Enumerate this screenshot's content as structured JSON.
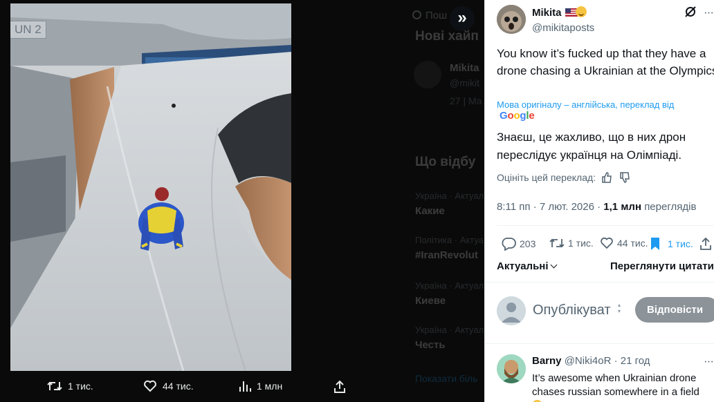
{
  "viewer": {
    "photo_badge": "UN 2",
    "background_page": {
      "search_placeholder": "Пош",
      "heading": "Нові хайп",
      "user_name": "Mikita",
      "user_handle": "@mikit",
      "user_date": "27 | Ма",
      "trends_heading": "Що відбу",
      "trends": [
        {
          "category": "Україна · Актуал",
          "title": "Какие"
        },
        {
          "category": "Політика · Актуа",
          "title": "#IranRevolut"
        },
        {
          "category": "Україна · Актуал",
          "title": "Киеве"
        },
        {
          "category": "Україна · Актуал",
          "title": "Честь"
        }
      ],
      "show_more": "Показати біль"
    },
    "actions": {
      "retweets": "1 тис.",
      "likes": "44 тис.",
      "views": "1 млн"
    }
  },
  "tweet": {
    "author_name": "Mikita",
    "author_handle": "@mikitaposts",
    "text": "You know it’s fucked up that they have a drone chasing a Ukrainian at the Olympics",
    "translation_note": "Мова оригіналу – англійська, переклад від",
    "translation_provider": "Google",
    "translated_text": "Знаєш, це жахливо, що в них дрон переслідує українця на Олімпіаді.",
    "rate_label": "Оцініть цей переклад:",
    "time": "8:11 пп",
    "date": "7 лют. 2026",
    "views": "1,1 млн",
    "views_label": "переглядів",
    "stats": {
      "replies": "203",
      "retweets": "1 тис.",
      "likes": "44 тис.",
      "bookmarks": "1 тис."
    }
  },
  "replies_section": {
    "sort_label": "Актуальні",
    "quotes_link": "Переглянути цитати",
    "reply_placeholder": "Опублікуват",
    "reply_button": "Відповісти"
  },
  "comment": {
    "name": "Barny",
    "handle": "@Niki4oR",
    "time": "21 год",
    "text": "It’s awesome when Ukrainian drone chases russian somewhere in a field"
  },
  "colors": {
    "accent": "#1d9bf0",
    "reply_button_bg": "#8c9399",
    "viewer_bg": "#0a0a0a"
  }
}
